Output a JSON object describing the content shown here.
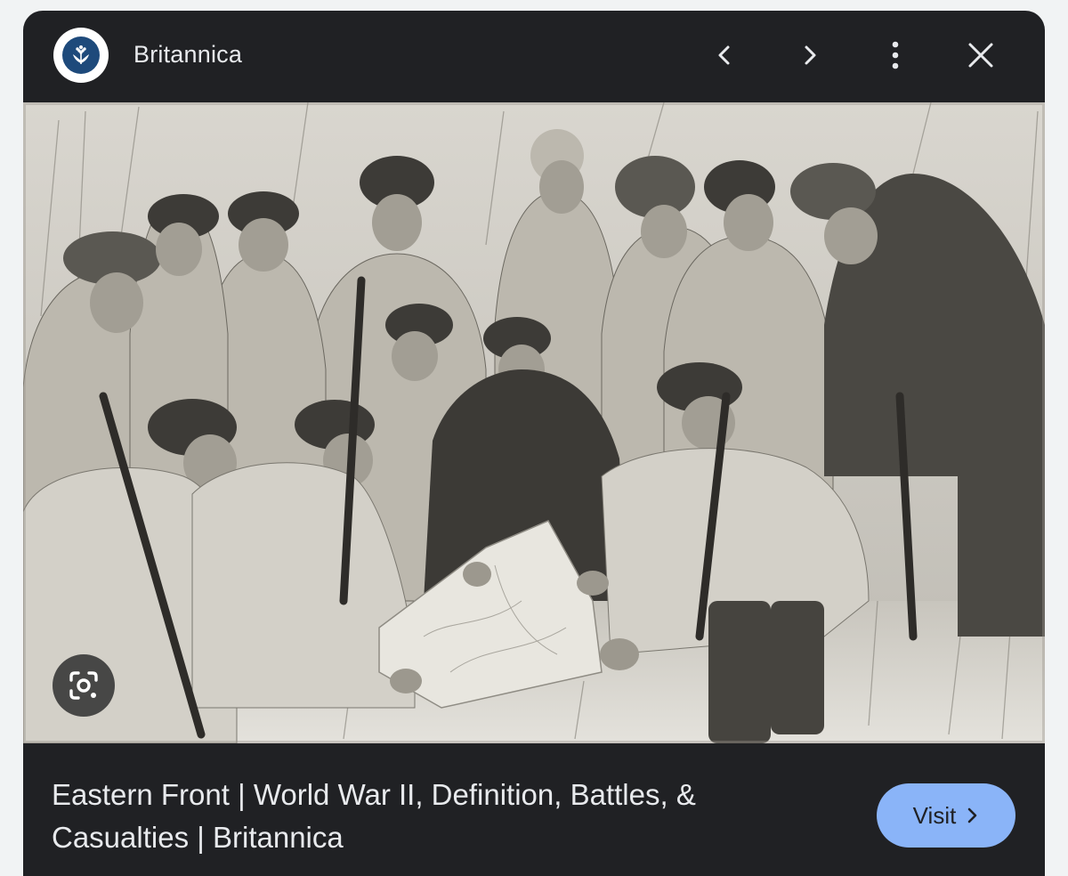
{
  "header": {
    "site_name": "Britannica",
    "icons": {
      "logo": "britannica-thistle-logo",
      "prev": "chevron-left-icon",
      "next": "chevron-right-icon",
      "more": "more-vert-icon",
      "close": "close-icon"
    }
  },
  "image": {
    "lens_icon": "google-lens-icon"
  },
  "footer": {
    "title": "Eastern Front | World War II, Definition, Battles, & Casualties | Britannica",
    "visit_label": "Visit",
    "visit_icon": "chevron-right-icon"
  },
  "colors": {
    "panel_bg": "#202124",
    "text": "#e8eaed",
    "visit_bg": "#8ab4f8",
    "logo_blue": "#1e4a7b"
  }
}
